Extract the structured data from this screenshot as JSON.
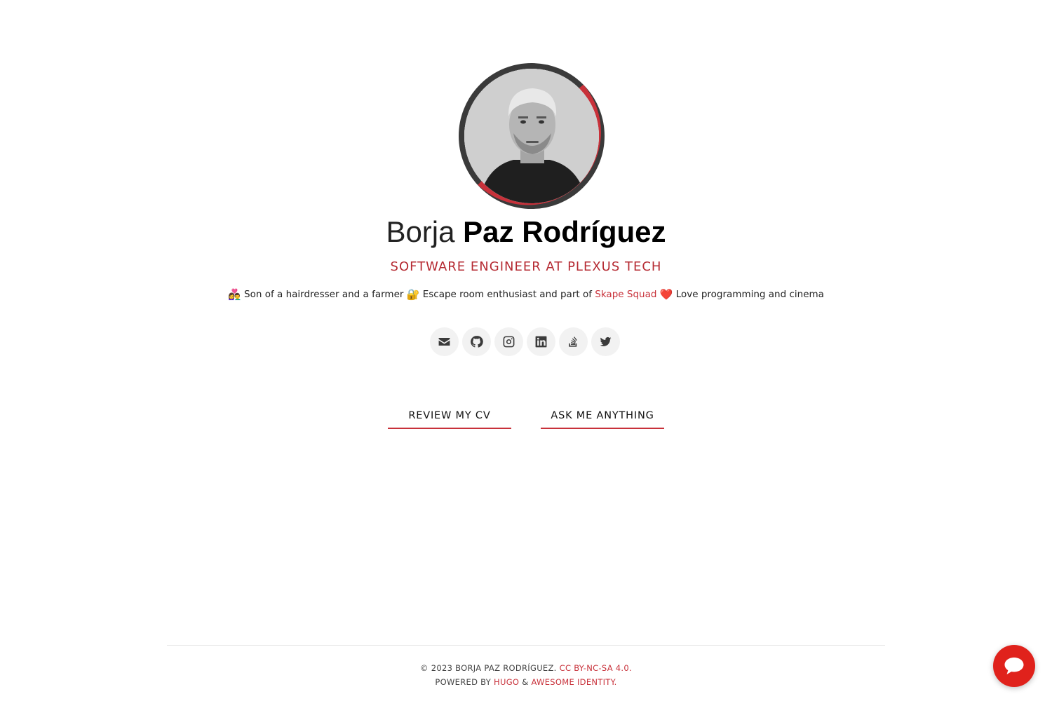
{
  "profile": {
    "first_name": "Borja",
    "last_name": "Paz Rodríguez",
    "title": "SOFTWARE ENGINEER AT PLEXUS TECH",
    "photo_alt": "Profile photo"
  },
  "bio": {
    "emoji1": "👩‍❤️‍👨",
    "part1": "Son of a hairdresser and a farmer",
    "emoji2": "🔐",
    "part2": "Escape room enthusiast and part of",
    "link_text": "Skape Squad",
    "emoji3": "❤️",
    "part3": "Love programming and cinema"
  },
  "socials": [
    {
      "icon": "envelope-icon"
    },
    {
      "icon": "github-icon"
    },
    {
      "icon": "instagram-icon"
    },
    {
      "icon": "linkedin-icon"
    },
    {
      "icon": "stackoverflow-icon"
    },
    {
      "icon": "twitter-icon"
    }
  ],
  "buttons": {
    "cv": "REVIEW MY CV",
    "ask": "ASK ME ANYTHING"
  },
  "footer": {
    "copyright": "© 2023 BORJA PAZ RODRÍGUEZ.",
    "license": "CC BY-NC-SA 4.0",
    "license_suffix": ".",
    "powered_by": "POWERED BY",
    "hugo": "HUGO",
    "amp": "&",
    "theme": "AWESOME IDENTITY",
    "theme_suffix": "."
  },
  "colors": {
    "accent": "#c8313a",
    "chat_button": "#e0221c",
    "ring_dark": "#3a3a3a"
  },
  "chat": {
    "icon": "chat-bubble-icon"
  }
}
